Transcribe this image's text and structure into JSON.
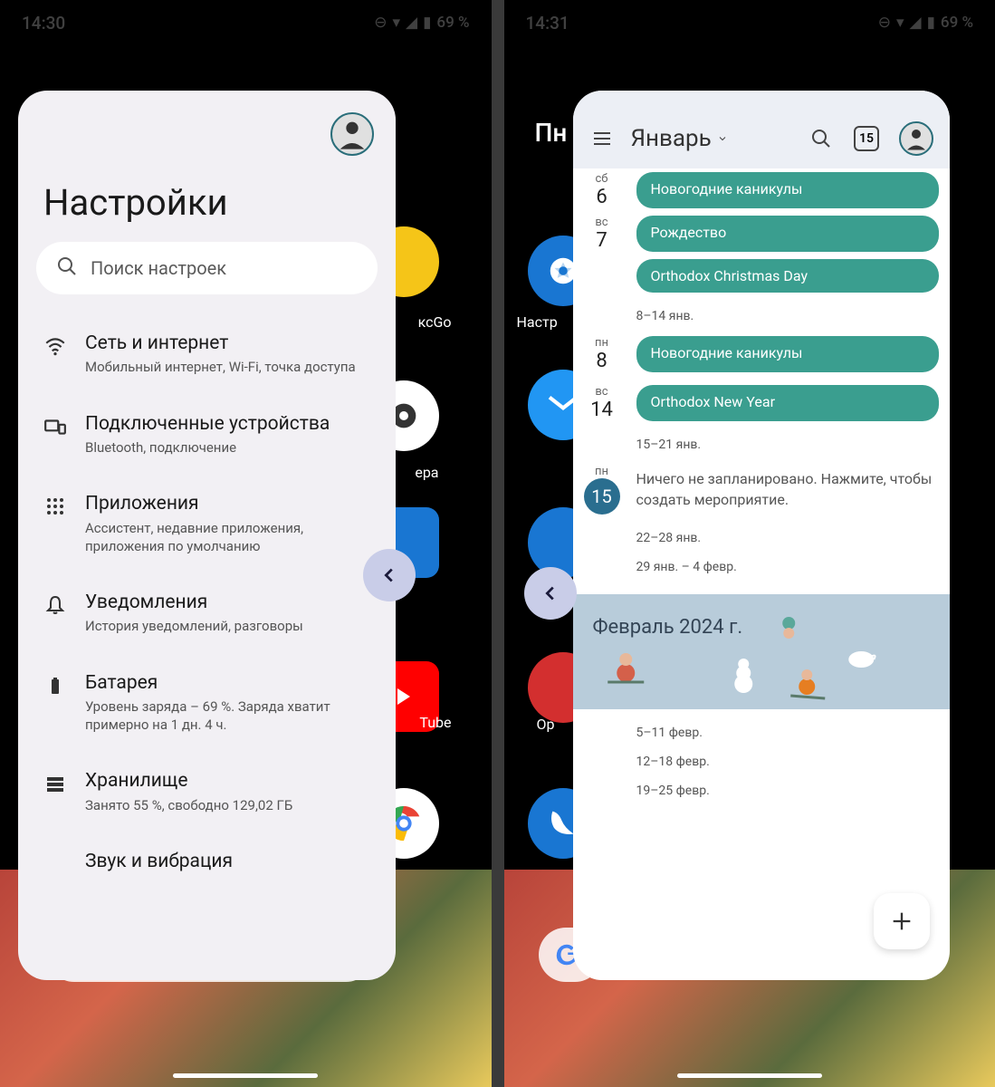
{
  "left": {
    "status": {
      "time": "14:30",
      "battery": "69 %"
    },
    "settings": {
      "title": "Настройки",
      "search_placeholder": "Поиск настроек",
      "items": [
        {
          "icon": "wifi",
          "label": "Сеть и интернет",
          "sub": "Мобильный интернет, Wi-Fi, точка доступа"
        },
        {
          "icon": "devices",
          "label": "Подключенные устройства",
          "sub": "Bluetooth, подключение"
        },
        {
          "icon": "apps",
          "label": "Приложения",
          "sub": "Ассистент, недавние приложения, приложения по умолчанию"
        },
        {
          "icon": "bell",
          "label": "Уведомления",
          "sub": "История уведомлений, разговоры"
        },
        {
          "icon": "battery",
          "label": "Батарея",
          "sub": "Уровень заряда – 69 %. Заряда хватит примерно на 1 дн. 4 ч."
        },
        {
          "icon": "storage",
          "label": "Хранилище",
          "sub": "Занято 55 %, свободно 129,02 ГБ"
        },
        {
          "icon": "sound",
          "label": "Звук и вибрация",
          "sub": ""
        }
      ]
    },
    "bg": {
      "app1_label": "ксGo",
      "app2_label": "ера",
      "app3_label": "Tube",
      "nastro_label": "Настр"
    }
  },
  "right": {
    "status": {
      "time": "14:31",
      "battery": "69 %"
    },
    "calendar": {
      "month_label": "Январь",
      "today_box": "15",
      "days": [
        {
          "dow": "сб",
          "num": "6",
          "event": "Новогодние каникулы"
        },
        {
          "dow": "вс",
          "num": "7",
          "event": "Рождество"
        },
        {
          "dow": "",
          "num": "",
          "event": "Orthodox Christmas Day"
        }
      ],
      "week1": "8–14 янв.",
      "day_mon8": {
        "dow": "пн",
        "num": "8",
        "event": "Новогодние каникулы"
      },
      "day_sun14": {
        "dow": "вс",
        "num": "14",
        "event": "Orthodox New Year"
      },
      "week2": "15–21 янв.",
      "today": {
        "dow": "пн",
        "num": "15"
      },
      "empty_msg": "Ничего не запланировано. Нажмите, чтобы создать мероприятие.",
      "week3": "22–28 янв.",
      "week4": "29 янв. – 4 февр.",
      "next_month": "Февраль 2024 г.",
      "feb_weeks": [
        "5–11 февр.",
        "12–18 февр.",
        "19–25 февр."
      ]
    },
    "bg": {
      "label1": "Пн",
      "nastr": "Настр",
      "opera": "Op"
    }
  }
}
